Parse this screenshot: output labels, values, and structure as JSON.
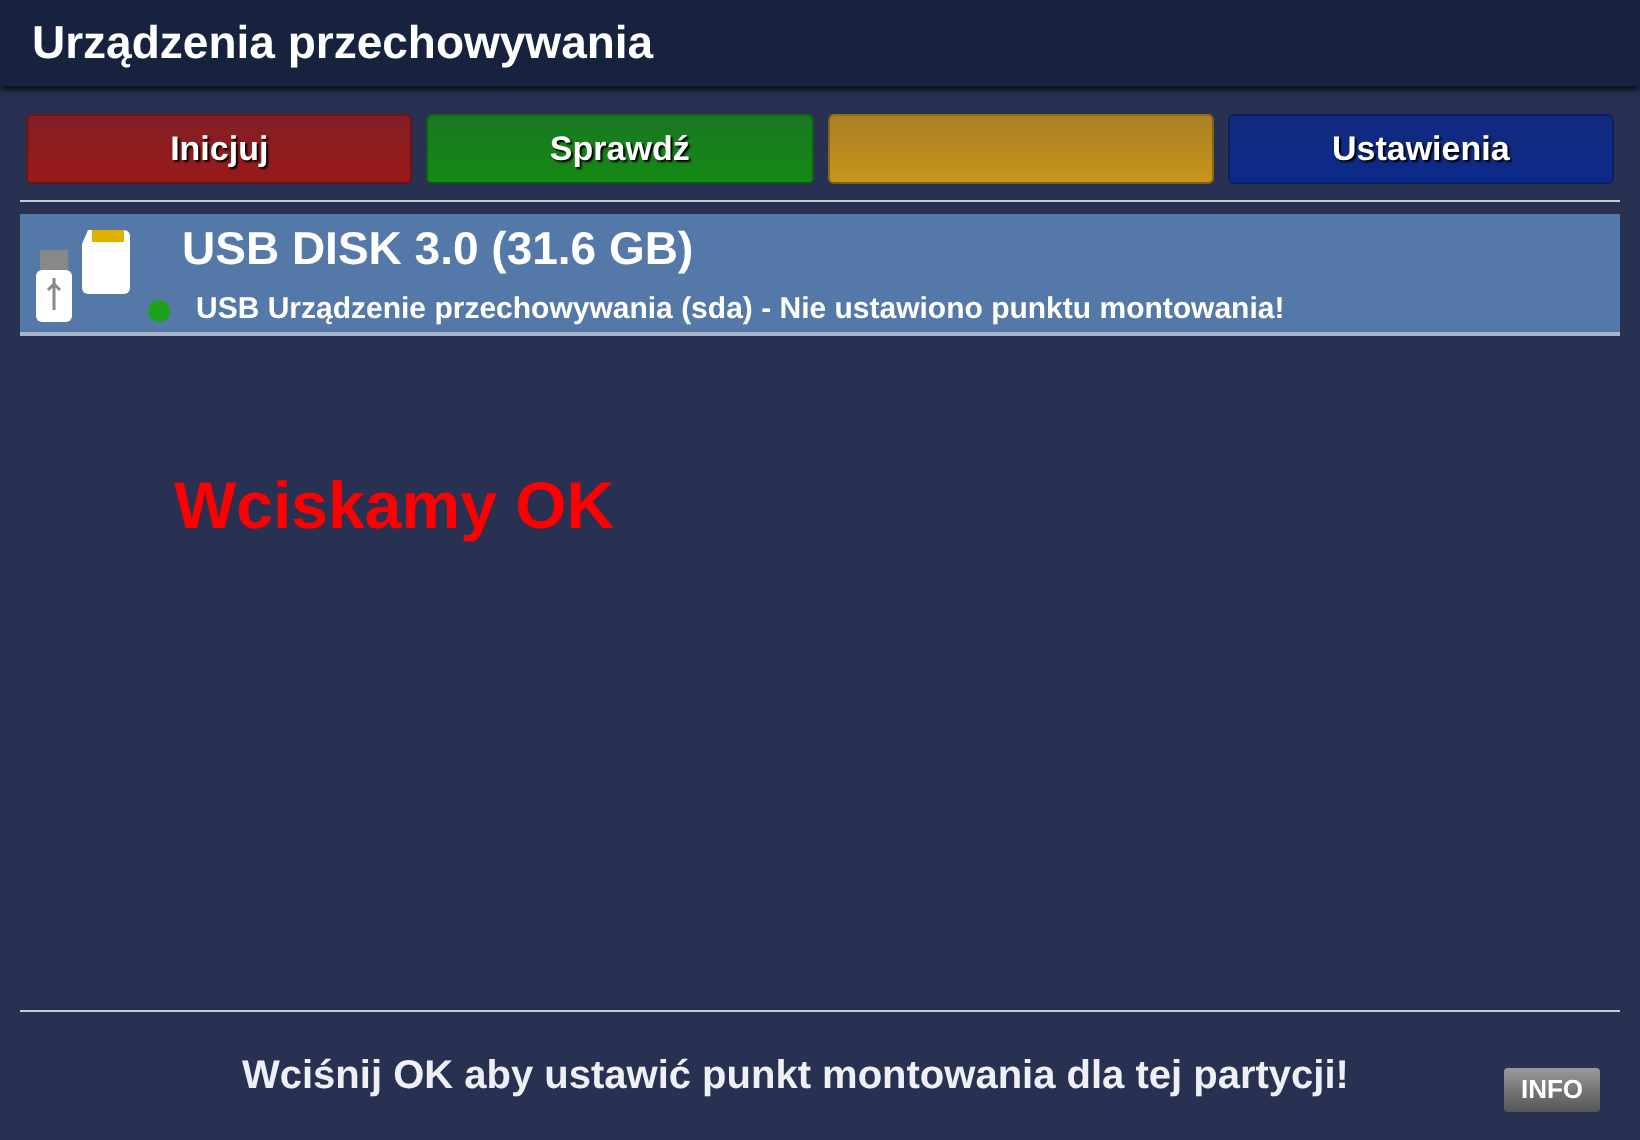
{
  "window": {
    "title": "Urządzenia przechowywania"
  },
  "buttons": [
    {
      "label": "Inicjuj",
      "color": "#9a1a1a"
    },
    {
      "label": "Sprawdź",
      "color": "#158a15"
    },
    {
      "color": "#c9951a"
    },
    {
      "label": "Ustawienia",
      "color": "#0d2a8a"
    }
  ],
  "devices": [
    {
      "name": "USB DISK 3.0 (31.6 GB)",
      "description": "USB Urządzenie przechowywania (sda) - Nie ustawiono punktu montowania!",
      "selected": true,
      "color": "#1aa31a"
    }
  ],
  "annotation": "Wciskamy OK",
  "status_bar": {
    "message": "Wciśnij OK aby ustawić punkt montowania dla tej partycji!",
    "info_button": "INFO"
  }
}
